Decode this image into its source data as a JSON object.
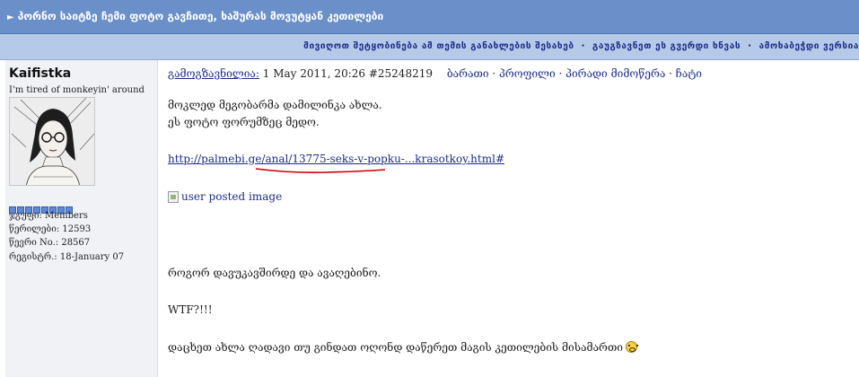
{
  "topic": {
    "title": "პორნო საიტზე ჩემი ფოტო გავჩითე, ხაშურას მოვუტყან კეთილები"
  },
  "nav": {
    "links": [
      "მივიღოთ შეტყობინება ამ თემის განახლების შესახებ",
      "გაუგზავნეთ ეს გვერდი ხნვას",
      "ამოხაბეჭდი ვერსია"
    ]
  },
  "user": {
    "name": "Kaifistka",
    "title": "I'm tired of monkeyin' around",
    "avatar_icon": "girl-with-glasses-sketch",
    "pip_count": 8,
    "pip_color": "#5e8ad6",
    "group": "ჯგუფი: Members",
    "posts": "წერილები: 12593",
    "member_no": "წევრი No.: 28567",
    "registered": "რეგისტრ.: 18-January 07"
  },
  "post": {
    "sent_label": "გამოგზავნილია:",
    "datetime": "1 May 2011, 20:26",
    "post_id": "#25248219",
    "actions": [
      "ბარათი",
      "პროფილი",
      "პირადი მიმოწერა",
      "ჩატი"
    ],
    "line1": "მოკლედ მეგობარმა დამილინკა ახლა.",
    "line2": "ეს ფოტო ფორუმზეც მედო.",
    "url": "http://palmebi.ge/anal/13775-seks-v-popku-...krasotkoy.html#",
    "image_alt": "user posted image",
    "line3": "როგორ დავუკავშირდე და ავაღებინო.",
    "line4": "WTF?!!!",
    "line5": "დაცხეთ ახლა ღადავი თუ გინდათ ოღონდ დაწერეთ მაგის კეთილების მისამართი",
    "smiley_icon": "smiley-icon",
    "underline_color": "#cc0000"
  }
}
